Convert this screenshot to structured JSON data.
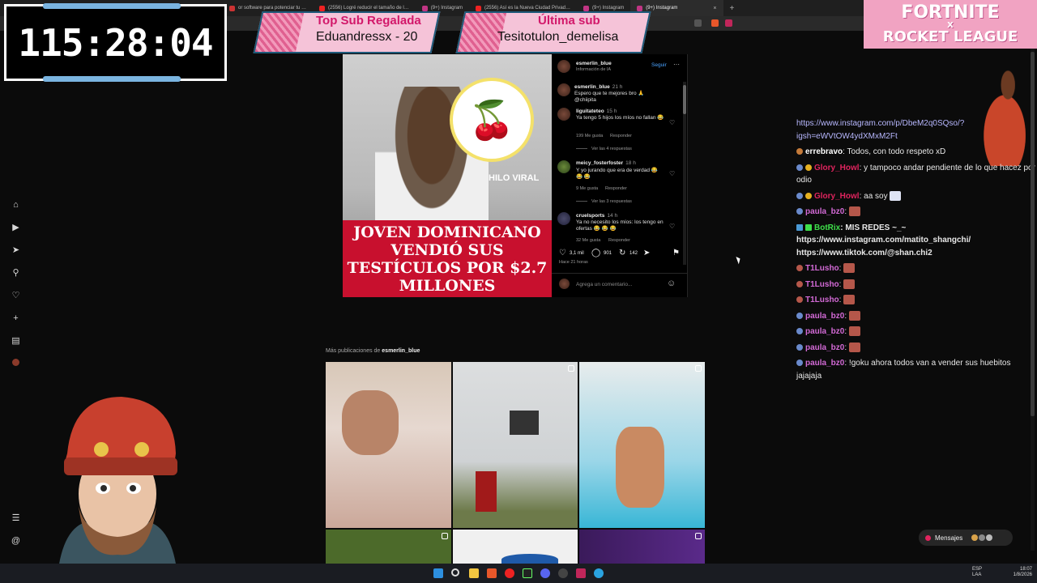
{
  "browser": {
    "tabs": [
      {
        "label": "or software para potenciar tu …",
        "color": "#c33"
      },
      {
        "label": "(2556) Logré reducir el tamaño de l…",
        "color": "#e22"
      },
      {
        "label": "(9+) Instagram",
        "color": "#c13584"
      },
      {
        "label": "(2556) Así es la Nueva Ciudad Privad…",
        "color": "#e22"
      },
      {
        "label": "(9+) Instagram",
        "color": "#c13584"
      },
      {
        "label": "(9+) Instagram",
        "color": "#c13584",
        "active": true
      }
    ],
    "close_glyph": "×",
    "new_tab_glyph": "+"
  },
  "timer": "115:28:04",
  "banners": {
    "top_sub_title": "Top Sub Regalada",
    "top_sub_name": "Eduandressx - 20",
    "last_sub_title": "Última sub",
    "last_sub_name": "Tesitotulon_demelisa"
  },
  "fortnite": {
    "line1": "FORTNITE",
    "line2": "X",
    "line3": "ROCKET LEAGUE"
  },
  "post": {
    "image_badge": "HILO VIRAL",
    "headline": "JOVEN DOMINICANO VENDIÓ SUS TESTÍCULOS POR $2.7 MILLONES",
    "author": "esmerlin_blue",
    "author_sub": "Información de IA",
    "follow": "Seguir",
    "more": "···",
    "comments": [
      {
        "user": "esmerlin_blue",
        "time": "21 h",
        "text": "Espero que te mejores bro 🙏 @chiipita"
      },
      {
        "user": "liguitateteo",
        "time": "15 h",
        "text": "Ya tengo 5 hijos los míos no fallan 😂",
        "likes": "199 Me gusta",
        "reply": "Responder",
        "more": "Ver las 4 respuestas"
      },
      {
        "user": "meicy_fosterfoster",
        "time": "18 h",
        "text": "Y yo jurando que era de verdad 😂 😂 😂",
        "likes": "9 Me gusta",
        "reply": "Responder",
        "more": "Ver las 3 respuestas"
      },
      {
        "user": "cruelsports",
        "time": "14 h",
        "text": "Ya no necesito los míos: los tengo en ofertas 😂 😂 😂",
        "likes": "32 Me gusta",
        "reply": "Responder"
      }
    ],
    "likes": "3,1 mil",
    "comments_count": "901",
    "reposts": "142",
    "posted_ago": "Hace 21 horas",
    "add_comment_placeholder": "Agrega un comentario...",
    "more_posts_prefix": "Más publicaciones de",
    "more_posts_user": "esmerlin_blue"
  },
  "chat": {
    "messages": [
      {
        "user": "",
        "text": "https://www.instagram.com/p/DbeM2q0SQso/?igsh=eWVtOW4ydXMxM2Ft",
        "is_link": true
      },
      {
        "user": "errebravo",
        "user_color": "#ffffff",
        "text": ": Todos, con todo respeto xD"
      },
      {
        "user": "Glory_Howl",
        "user_color": "#e0245e",
        "text": ": y tampoco andar pendiente de lo que hacez por odio"
      },
      {
        "user": "Glory_Howl",
        "user_color": "#e0245e",
        "text": ": aa soy"
      },
      {
        "user": "paula_bz0",
        "user_color": "#d36ad6",
        "text": ":"
      },
      {
        "user": "BotRix",
        "user_color": "#3ee04a",
        "text": ": MIS REDES ~_~ https://www.instagram.com/matito_shangchi/ https://www.tiktok.com/@shan.chi2"
      },
      {
        "user": "T1Lusho",
        "user_color": "#d36ad6",
        "text": ":"
      },
      {
        "user": "T1Lusho",
        "user_color": "#d36ad6",
        "text": ":"
      },
      {
        "user": "T1Lusho",
        "user_color": "#d36ad6",
        "text": ":"
      },
      {
        "user": "paula_bz0",
        "user_color": "#d36ad6",
        "text": ":"
      },
      {
        "user": "paula_bz0",
        "user_color": "#d36ad6",
        "text": ":"
      },
      {
        "user": "paula_bz0",
        "user_color": "#d36ad6",
        "text": ":"
      },
      {
        "user": "paula_bz0",
        "user_color": "#d36ad6",
        "text": ": !goku ahora todos van a vender sus huebitos jajajaja"
      }
    ]
  },
  "messages_pill": "Mensajes",
  "system": {
    "lang": "ESP",
    "lang2": "LAA",
    "time": "18:07",
    "date": "1/8/2026"
  },
  "icons": {
    "home": "home-icon",
    "reels": "reels-icon",
    "explore": "explore-icon",
    "search": "search-icon",
    "notifications": "heart-icon",
    "create": "plus-icon",
    "stats": "stats-icon",
    "profile": "profile-icon",
    "menu": "hamburger-icon",
    "threads": "threads-icon"
  }
}
